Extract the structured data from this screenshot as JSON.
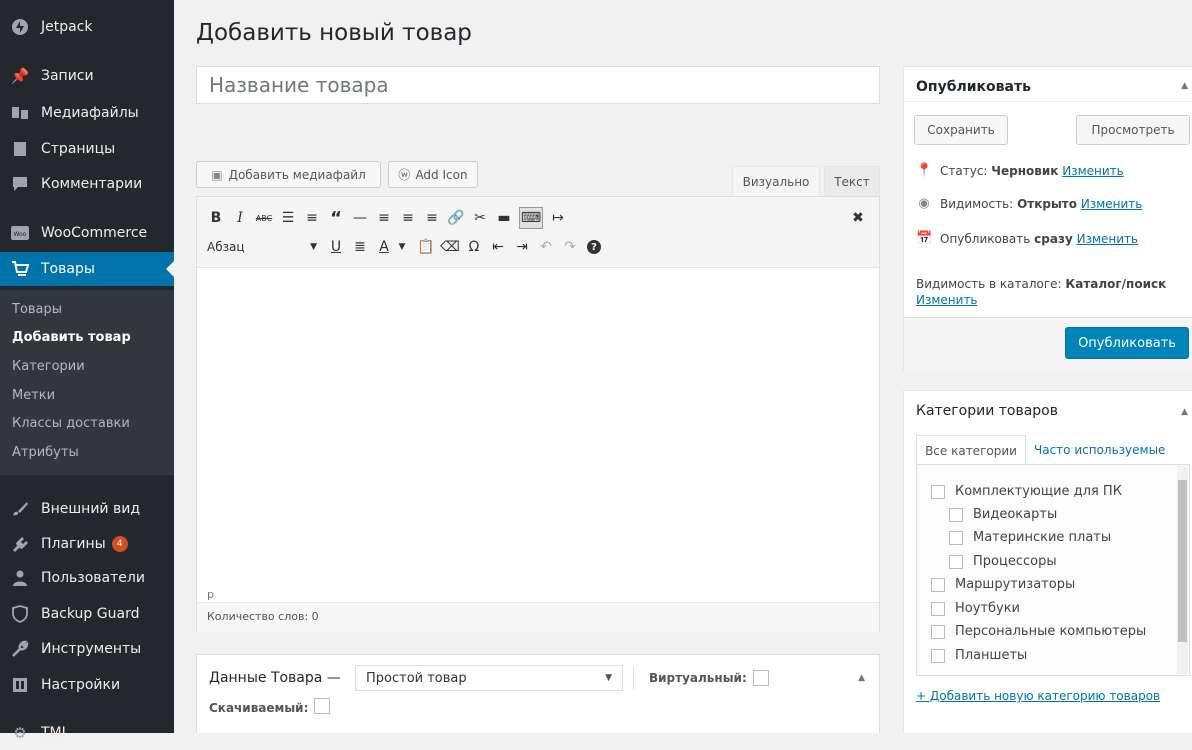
{
  "sidebar": {
    "items": [
      {
        "label": "Jetpack",
        "icon": "jetpack-icon"
      },
      {
        "label": "Записи",
        "icon": "pin-icon"
      },
      {
        "label": "Медиафайлы",
        "icon": "media-icon"
      },
      {
        "label": "Страницы",
        "icon": "page-icon"
      },
      {
        "label": "Комментарии",
        "icon": "comment-icon"
      },
      {
        "label": "WooCommerce",
        "icon": "woo-icon"
      },
      {
        "label": "Товары",
        "icon": "cart-icon"
      },
      {
        "label": "Внешний вид",
        "icon": "brush-icon"
      },
      {
        "label": "Плагины",
        "icon": "plugin-icon",
        "badge": "4"
      },
      {
        "label": "Пользователи",
        "icon": "user-icon"
      },
      {
        "label": "Backup Guard",
        "icon": "shield-icon"
      },
      {
        "label": "Инструменты",
        "icon": "wrench-icon"
      },
      {
        "label": "Настройки",
        "icon": "settings-icon"
      },
      {
        "label": "TMI",
        "icon": "gear-icon"
      }
    ],
    "submenu": [
      "Товары",
      "Добавить товар",
      "Категории",
      "Метки",
      "Классы доставки",
      "Атрибуты"
    ]
  },
  "page": {
    "title": "Добавить новый товар",
    "title_placeholder": "Название товара"
  },
  "editor": {
    "add_media": "Добавить медиафайл",
    "add_icon": "Add Icon",
    "tab_visual": "Визуально",
    "tab_text": "Текст",
    "format_select": "Абзац",
    "path": "p",
    "word_count": "Количество слов: 0"
  },
  "product_data": {
    "label": "Данные Товара —",
    "type_value": "Простой товар",
    "virtual_label": "Виртуальный:",
    "downloadable_label": "Скачиваемый:"
  },
  "publish": {
    "title": "Опубликовать",
    "save": "Сохранить",
    "preview": "Просмотреть",
    "status_label": "Статус:",
    "status_value": "Черновик",
    "visibility_label": "Видимость:",
    "visibility_value": "Открыто",
    "publish_label": "Опубликовать",
    "publish_value": "сразу",
    "change": "Изменить",
    "catalog_label": "Видимость в каталоге:",
    "catalog_value": "Каталог/поиск",
    "publish_button": "Опубликовать"
  },
  "categories": {
    "title": "Категории товаров",
    "tab_all": "Все категории",
    "tab_popular": "Часто используемые",
    "items": [
      {
        "label": "Комплектующие для ПК",
        "level": 0
      },
      {
        "label": "Видеокарты",
        "level": 1
      },
      {
        "label": "Материнские платы",
        "level": 1
      },
      {
        "label": "Процессоры",
        "level": 1
      },
      {
        "label": "Маршрутизаторы",
        "level": 0
      },
      {
        "label": "Ноутбуки",
        "level": 0
      },
      {
        "label": "Персональные компьютеры",
        "level": 0
      },
      {
        "label": "Планшеты",
        "level": 0
      }
    ],
    "add_link": "+ Добавить новую категорию товаров"
  },
  "colors": {
    "sidebar_bg": "#23282d",
    "accent": "#0073aa",
    "badge": "#d54e21"
  }
}
